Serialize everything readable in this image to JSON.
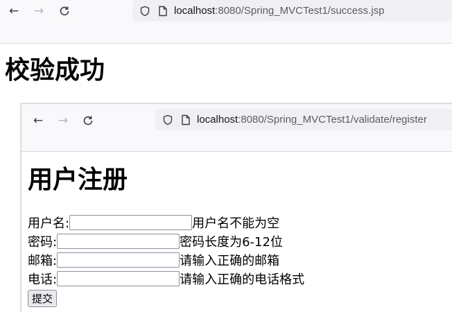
{
  "outer_browser": {
    "url_host": "localhost",
    "url_rest": ":8080/Spring_MVCTest1/success.jsp"
  },
  "outer_page": {
    "heading": "校验成功"
  },
  "inner_browser": {
    "url_host": "localhost",
    "url_rest": ":8080/Spring_MVCTest1/validate/register"
  },
  "inner_page": {
    "heading": "用户注册",
    "fields": [
      {
        "label": "用户名:",
        "value": "",
        "error": "用户名不能为空"
      },
      {
        "label": "密码:",
        "value": "",
        "error": "密码长度为6-12位"
      },
      {
        "label": "邮箱:",
        "value": "",
        "error": "请输入正确的邮箱"
      },
      {
        "label": "电话:",
        "value": "",
        "error": "请输入正确的电话格式"
      }
    ],
    "submit_label": "提交"
  },
  "icons": {
    "back": "back-arrow-icon",
    "forward": "forward-arrow-icon",
    "reload": "reload-icon",
    "tracking_protection": "shield-icon",
    "page_info": "page-icon"
  },
  "colors": {
    "toolbar_bg": "#f9f9fb",
    "urlbar_bg": "#f0f0f4"
  }
}
